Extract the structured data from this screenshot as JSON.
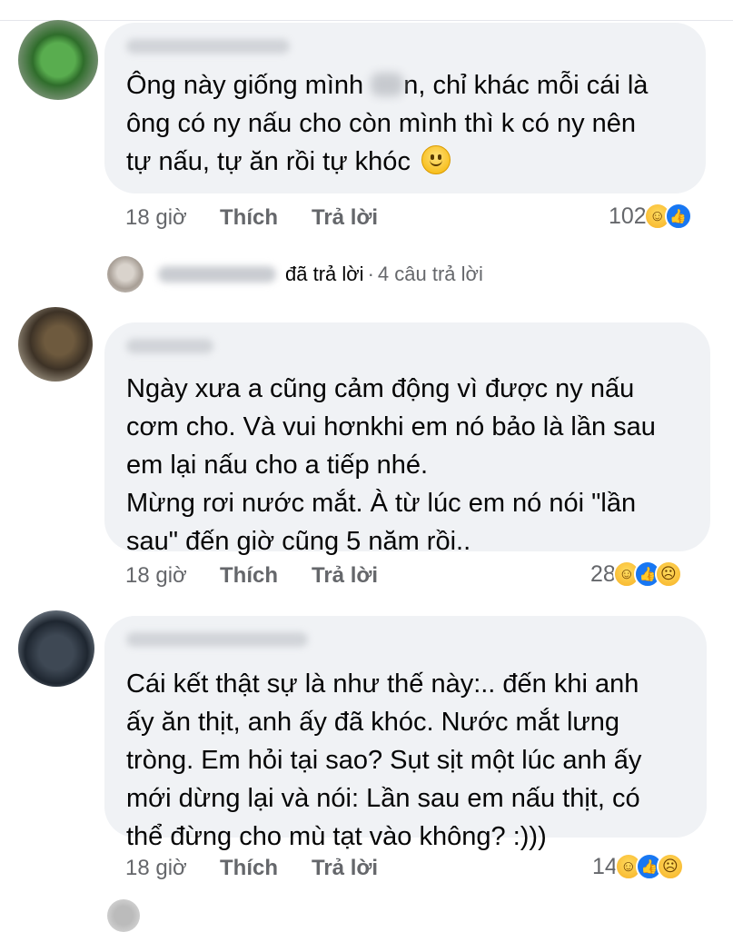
{
  "comments": [
    {
      "lines": [
        "Ông này giống mình ",
        "ông có ny nấu cho còn mình thì k có ny nên",
        "tự nấu, tự ăn rồi tự khóc"
      ],
      "line1_tail": "n, chỉ khác mỗi cái là",
      "time": "18 giờ",
      "like_label": "Thích",
      "reply_label": "Trả lời",
      "reaction_count": "102",
      "reaction_icons": [
        "haha-icon",
        "like-icon"
      ]
    },
    {
      "lines": [
        "Ngày xưa a cũng cảm động vì được ny nấu",
        "cơm cho. Và vui hơnkhi em nó bảo là lần sau",
        "em lại nấu cho a tiếp nhé.",
        "Mừng rơi nước mắt. À từ lúc em nó nói \"lần",
        "sau\" đến giờ cũng 5 năm rồi.."
      ],
      "time": "18 giờ",
      "like_label": "Thích",
      "reply_label": "Trả lời",
      "reaction_count": "28",
      "reaction_icons": [
        "haha-icon",
        "like-icon",
        "sad-icon"
      ]
    },
    {
      "lines": [
        "Cái kết thật sự là như thế này:.. đến khi anh",
        "ấy ăn thịt, anh ấy đã khóc. Nước mắt lưng",
        "tròng. Em hỏi tại sao? Sụt sịt một lúc anh ấy",
        "mới dừng lại và nói: Lần sau em nấu thịt, có",
        "thể đừng cho mù tạt vào không? :)))"
      ],
      "time": "18 giờ",
      "like_label": "Thích",
      "reply_label": "Trả lời",
      "reaction_count": "14",
      "reaction_icons": [
        "haha-icon",
        "like-icon",
        "sad-icon"
      ]
    }
  ],
  "replies_summary": {
    "text": "đã trả lời",
    "dot": "·",
    "count": "4 câu trả lời"
  },
  "colors": {
    "bubble": "#f0f2f5",
    "meta_text": "#65676b",
    "like_blue": "#1877f2"
  }
}
